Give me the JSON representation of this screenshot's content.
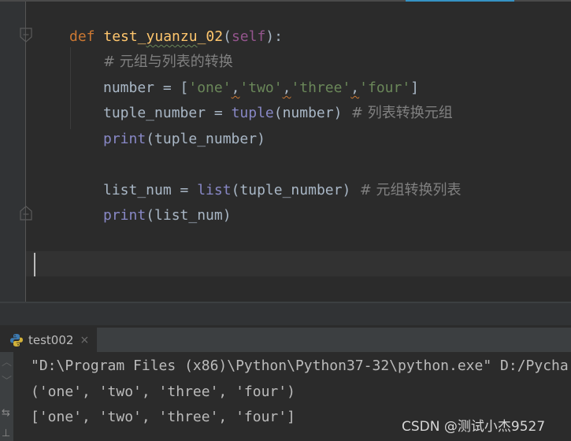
{
  "editor": {
    "lines": [
      {
        "def_kw": "def",
        "func_name_a": "test_",
        "func_name_typo": "yuanzu",
        "func_name_b": "_02",
        "open": "(",
        "self_kw": "self",
        "close": "):"
      },
      {
        "comment": "# 元组与列表的转换"
      },
      {
        "var": "number = [",
        "items": [
          "'one'",
          "'two'",
          "'three'",
          "'four'"
        ],
        "comma": ",",
        "end": "]"
      },
      {
        "var": "tuple_number = ",
        "builtin": "tuple",
        "args": "(number)",
        "comment": "  # 列表转换元组"
      },
      {
        "builtin": "print",
        "args": "(tuple_number)"
      },
      {
        "var": "list_num = ",
        "builtin": "list",
        "args": "(tuple_number)",
        "comment": "  # 元组转换列表"
      },
      {
        "builtin": "print",
        "args": "(list_num)"
      }
    ]
  },
  "run_panel": {
    "tab_label": "test002",
    "tab_icon": "python-icon",
    "close_glyph": "×",
    "output": [
      "\"D:\\Program Files (x86)\\Python\\Python37-32\\python.exe\" D:/Pycha",
      "('one', 'two', 'three', 'four')",
      "['one', 'two', 'three', 'four']"
    ],
    "side_icons": [
      "up-arrow-icon",
      "down-arrow-icon",
      "wrap-icon",
      "pin-icon"
    ]
  },
  "watermark": "CSDN @测试小杰9527",
  "colors": {
    "background": "#2b2b2b",
    "keyword": "#cc7832",
    "function": "#ffc66d",
    "self": "#94558d",
    "string": "#6a8759",
    "builtin": "#8888c6",
    "comment": "#808080",
    "tab_accent": "#3592c4"
  }
}
